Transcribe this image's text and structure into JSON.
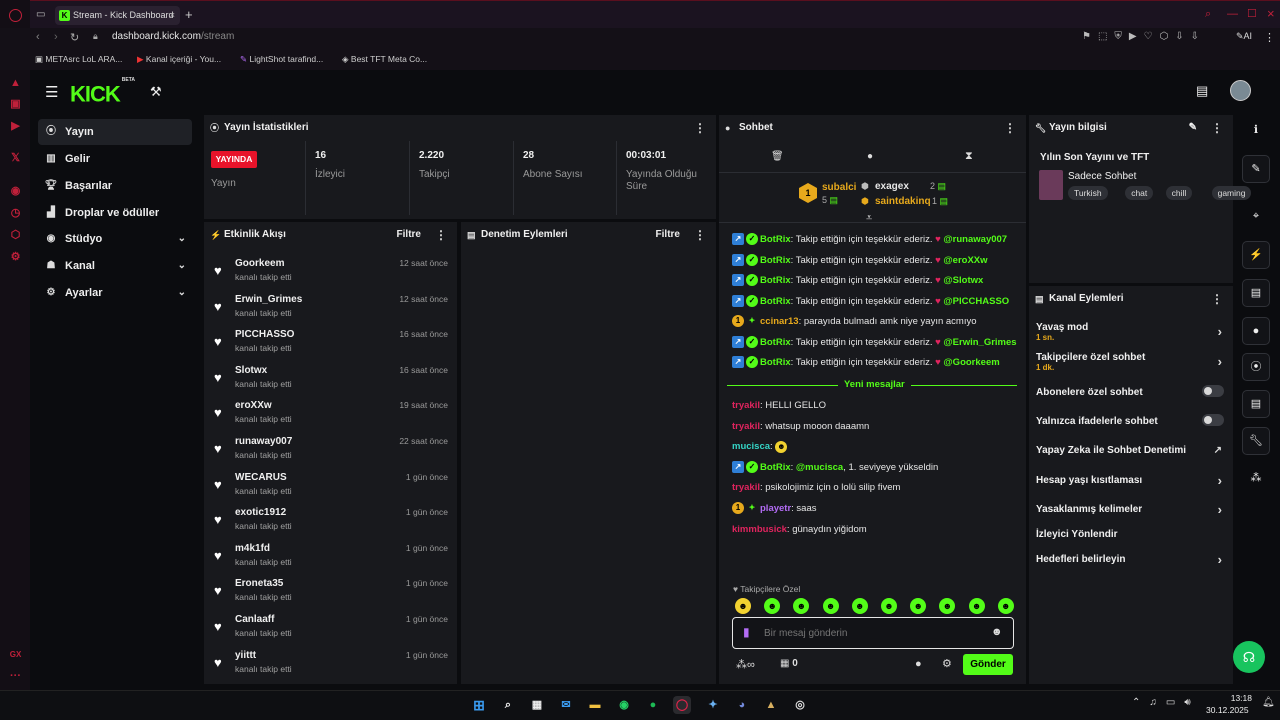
{
  "browser": {
    "tab_title": "Stream - Kick Dashboard",
    "url_host": "dashboard.kick.com",
    "url_path": "/stream",
    "bookmarks": [
      "METAsrc LoL ARA...",
      "Kanal içeriği - You...",
      "LightShot tarafind...",
      "Best TFT Meta Co..."
    ]
  },
  "brand": {
    "logo": "KICK",
    "beta": "BETA",
    "accent": "#53fc18"
  },
  "sidebar": {
    "items": [
      {
        "label": "Yayın",
        "icon": "broadcast-icon"
      },
      {
        "label": "Gelir",
        "icon": "revenue-icon"
      },
      {
        "label": "Başarılar",
        "icon": "trophy-icon"
      },
      {
        "label": "Droplar ve ödüller",
        "icon": "drops-icon"
      },
      {
        "label": "Stüdyo",
        "icon": "studio-icon"
      },
      {
        "label": "Kanal",
        "icon": "channel-icon"
      },
      {
        "label": "Ayarlar",
        "icon": "gear-icon"
      }
    ]
  },
  "stats": {
    "title": "Yayın İstatistikleri",
    "live_badge": "YAYINDA",
    "live_label": "Yayın",
    "items": [
      {
        "value": "16",
        "label": "İzleyici"
      },
      {
        "value": "2.220",
        "label": "Takipçi"
      },
      {
        "value": "28",
        "label": "Abone Sayısı"
      },
      {
        "value": "00:03:01",
        "label": "Yayında Olduğu Süre"
      }
    ]
  },
  "activity": {
    "title": "Etkinlik Akışı",
    "filter": "Filtre",
    "items": [
      {
        "name": "Goorkeem",
        "sub": "kanalı takip etti",
        "time": "12 saat önce"
      },
      {
        "name": "Erwin_Grimes",
        "sub": "kanalı takip etti",
        "time": "12 saat önce"
      },
      {
        "name": "PICCHASSO",
        "sub": "kanalı takip etti",
        "time": "16 saat önce"
      },
      {
        "name": "Slotwx",
        "sub": "kanalı takip etti",
        "time": "16 saat önce"
      },
      {
        "name": "eroXXw",
        "sub": "kanalı takip etti",
        "time": "19 saat önce"
      },
      {
        "name": "runaway007",
        "sub": "kanalı takip etti",
        "time": "22 saat önce"
      },
      {
        "name": "WECARUS",
        "sub": "kanalı takip etti",
        "time": "1 gün önce"
      },
      {
        "name": "exotic1912",
        "sub": "kanalı takip etti",
        "time": "1 gün önce"
      },
      {
        "name": "m4k1fd",
        "sub": "kanalı takip etti",
        "time": "1 gün önce"
      },
      {
        "name": "Eroneta35",
        "sub": "kanalı takip etti",
        "time": "1 gün önce"
      },
      {
        "name": "Canlaaff",
        "sub": "kanalı takip etti",
        "time": "1 gün önce"
      },
      {
        "name": "yiittt",
        "sub": "kanalı takip etti",
        "time": "1 gün önce"
      }
    ]
  },
  "moderation": {
    "title": "Denetim Eylemleri",
    "filter": "Filtre"
  },
  "chat": {
    "title": "Sohbet",
    "leaderboard": [
      {
        "name": "subalci",
        "count": "5"
      },
      {
        "name": "exagex",
        "count": "2"
      },
      {
        "name": "saintdakinq",
        "count": "1"
      }
    ],
    "messages": [
      {
        "user": "BotRix",
        "cls": "u-green",
        "badges": "bot",
        "text": ": Takip ettiğin için teşekkür ederiz. ",
        "heart": "♥",
        "mention": "@runaway007"
      },
      {
        "user": "BotRix",
        "cls": "u-green",
        "badges": "bot",
        "text": ": Takip ettiğin için teşekkür ederiz. ",
        "heart": "♥",
        "mention": "@eroXXw"
      },
      {
        "user": "BotRix",
        "cls": "u-green",
        "badges": "bot",
        "text": ": Takip ettiğin için teşekkür ederiz. ",
        "heart": "♥",
        "mention": "@Slotwx"
      },
      {
        "user": "BotRix",
        "cls": "u-green",
        "badges": "bot",
        "text": ": Takip ettiğin için teşekkür ederiz. ",
        "heart": "♥",
        "mention": "@PICCHASSO"
      },
      {
        "user": "ccinar13",
        "cls": "u-orange",
        "badges": "gold",
        "text": ": parayıda bulmadı amk niye yayın acmıyo",
        "heart": "",
        "mention": ""
      },
      {
        "user": "BotRix",
        "cls": "u-green",
        "badges": "bot",
        "text": ": Takip ettiğin için teşekkür ederiz. ",
        "heart": "♥",
        "mention": "@Erwin_Grimes"
      },
      {
        "user": "BotRix",
        "cls": "u-green",
        "badges": "bot",
        "text": ": Takip ettiğin için teşekkür ederiz. ",
        "heart": "♥",
        "mention": "@Goorkeem"
      }
    ],
    "new_messages": "Yeni mesajlar",
    "messages2": [
      {
        "user": "tryakil",
        "cls": "u-red",
        "badges": "",
        "text": ": HELLI GELLO",
        "mention": ""
      },
      {
        "user": "tryakil",
        "cls": "u-red",
        "badges": "",
        "text": ": whatsup mooon daaamn",
        "mention": ""
      },
      {
        "user": "mucisca",
        "cls": "u-teal",
        "badges": "",
        "text": ": ",
        "mention": ""
      },
      {
        "user": "BotRix",
        "cls": "u-green",
        "badges": "bot",
        "text": ", 1. seviyeye yükseldin",
        "mention": "@mucisca",
        "mfirst": true
      },
      {
        "user": "tryakil",
        "cls": "u-red",
        "badges": "",
        "text": ": psikolojimiz için o lolü silip fivem",
        "mention": ""
      },
      {
        "user": "playetr",
        "cls": "u-purple",
        "badges": "gold",
        "text": ": saas",
        "mention": ""
      },
      {
        "user": "kimmbusick",
        "cls": "u-red",
        "badges": "",
        "text": ": günaydın yiğidom",
        "mention": ""
      }
    ],
    "followers_only": "Takipçilere Özel",
    "input_placeholder": "Bir mesaj gönderin",
    "points_symbol": "∞",
    "gift_count": "0",
    "send_label": "Gönder"
  },
  "stream_info": {
    "title_header": "Yayın bilgisi",
    "stream_title": "Yılın Son Yayını ve TFT",
    "category": "Sadece Sohbet",
    "tags": [
      "Turkish",
      "chat",
      "chill",
      "gaming"
    ]
  },
  "channel_actions": {
    "title": "Kanal Eylemleri",
    "items": [
      {
        "label": "Yavaş mod",
        "sub": "1 sn.",
        "control": "arrow"
      },
      {
        "label": "Takipçilere özel sohbet",
        "sub": "1 dk.",
        "control": "arrow"
      },
      {
        "label": "Abonelere özel sohbet",
        "sub": "",
        "control": "toggle"
      },
      {
        "label": "Yalnızca ifadelerle sohbet",
        "sub": "",
        "control": "toggle"
      },
      {
        "label": "Yapay Zeka ile Sohbet Denetimi",
        "sub": "",
        "control": "external"
      },
      {
        "label": "Hesap yaşı kısıtlaması",
        "sub": "",
        "control": "arrow"
      },
      {
        "label": "Yasaklanmış kelimeler",
        "sub": "",
        "control": "arrow"
      },
      {
        "label": "İzleyici Yönlendir",
        "sub": "",
        "control": "none"
      },
      {
        "label": "Hedefleri belirleyin",
        "sub": "",
        "control": "arrow"
      }
    ]
  },
  "taskbar": {
    "time": "13:18",
    "date": "30.12.2025"
  }
}
